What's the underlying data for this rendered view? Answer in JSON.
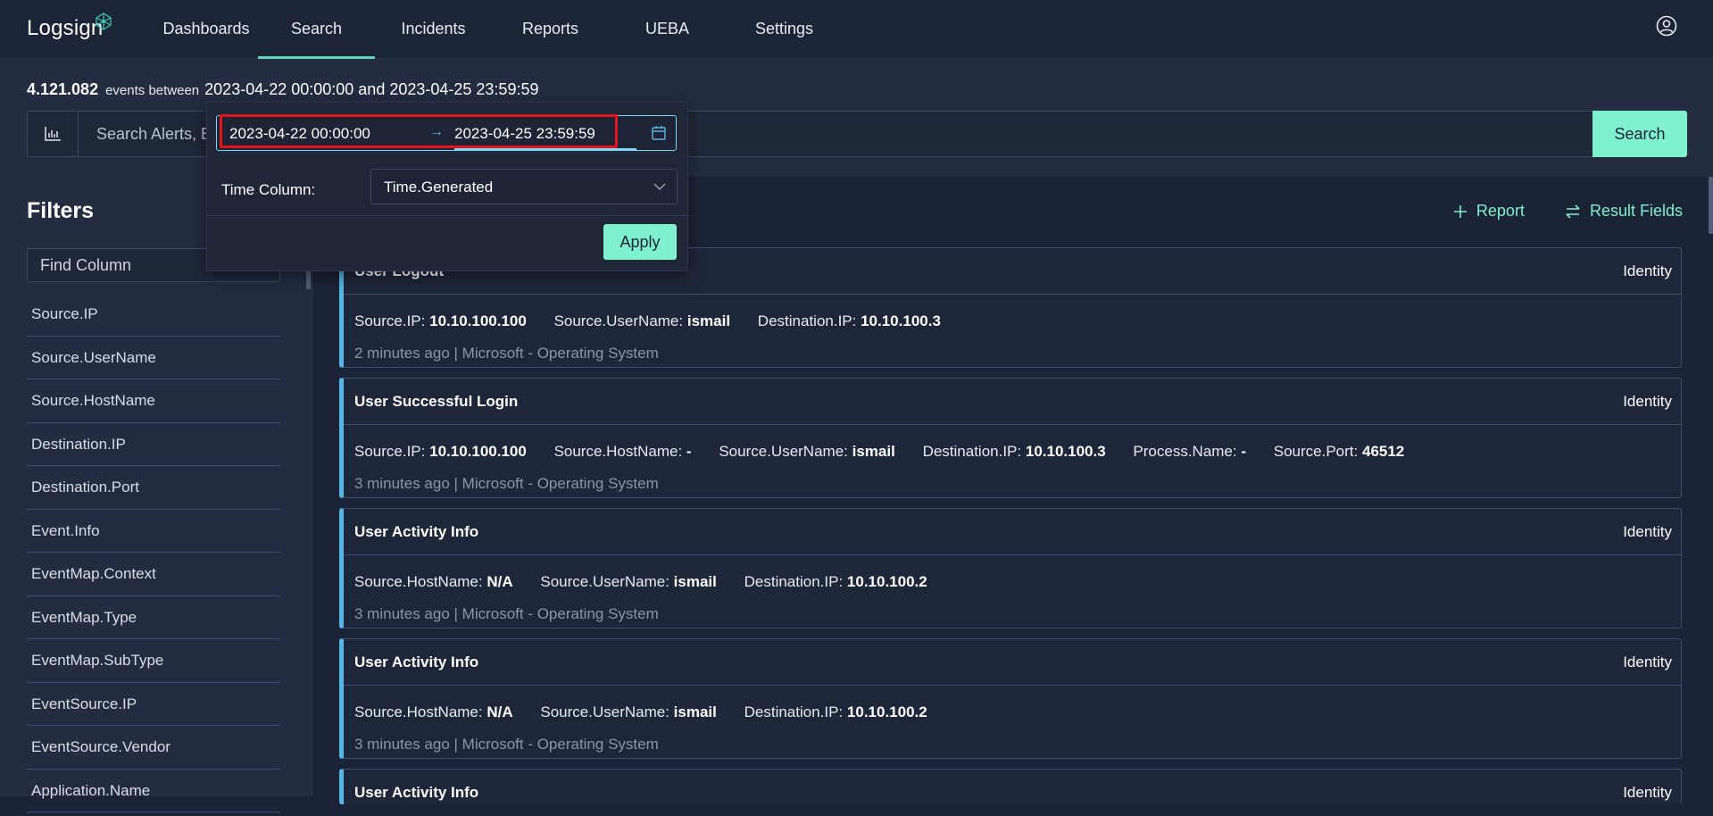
{
  "app": {
    "logo_text": "Logsign"
  },
  "nav": {
    "items": [
      "Dashboards",
      "Search",
      "Incidents",
      "Reports",
      "UEBA",
      "Settings"
    ],
    "active": "Search"
  },
  "stats": {
    "count": "4.121.082",
    "between_label": "events between",
    "range": "2023-04-22 00:00:00 and 2023-04-25 23:59:59"
  },
  "search": {
    "placeholder": "Search Alerts, Events",
    "button_label": "Search"
  },
  "date_popup": {
    "start": "2023-04-22 00:00:00",
    "arrow": "→",
    "end": "2023-04-25 23:59:59",
    "time_column_label": "Time Column:",
    "time_column_value": "Time.Generated",
    "apply_label": "Apply"
  },
  "filters": {
    "title": "Filters",
    "find_placeholder": "Find Column",
    "fields": [
      "Source.IP",
      "Source.UserName",
      "Source.HostName",
      "Destination.IP",
      "Destination.Port",
      "Event.Info",
      "EventMap.Context",
      "EventMap.Type",
      "EventMap.SubType",
      "EventSource.IP",
      "EventSource.Vendor",
      "Application.Name"
    ]
  },
  "results": {
    "report_label": "Report",
    "result_fields_label": "Result Fields",
    "cards": [
      {
        "title": "User Logout",
        "category": "Identity",
        "fields": [
          {
            "k": "Source.IP:",
            "v": "10.10.100.100"
          },
          {
            "k": "Source.UserName:",
            "v": "ismail"
          },
          {
            "k": "Destination.IP:",
            "v": "10.10.100.3"
          }
        ],
        "meta": "2 minutes ago | Microsoft - Operating System"
      },
      {
        "title": "User Successful Login",
        "category": "Identity",
        "fields": [
          {
            "k": "Source.IP:",
            "v": "10.10.100.100"
          },
          {
            "k": "Source.HostName:",
            "v": "-"
          },
          {
            "k": "Source.UserName:",
            "v": "ismail"
          },
          {
            "k": "Destination.IP:",
            "v": "10.10.100.3"
          },
          {
            "k": "Process.Name:",
            "v": "-"
          },
          {
            "k": "Source.Port:",
            "v": "46512"
          }
        ],
        "meta": "3 minutes ago | Microsoft - Operating System"
      },
      {
        "title": "User Activity Info",
        "category": "Identity",
        "fields": [
          {
            "k": "Source.HostName:",
            "v": "N/A"
          },
          {
            "k": "Source.UserName:",
            "v": "ismail"
          },
          {
            "k": "Destination.IP:",
            "v": "10.10.100.2"
          }
        ],
        "meta": "3 minutes ago | Microsoft - Operating System"
      },
      {
        "title": "User Activity Info",
        "category": "Identity",
        "fields": [
          {
            "k": "Source.HostName:",
            "v": "N/A"
          },
          {
            "k": "Source.UserName:",
            "v": "ismail"
          },
          {
            "k": "Destination.IP:",
            "v": "10.10.100.2"
          }
        ],
        "meta": "3 minutes ago | Microsoft - Operating System"
      },
      {
        "title": "User Activity Info",
        "category": "Identity",
        "fields": [],
        "meta": ""
      }
    ]
  },
  "colors": {
    "accent": "#7ff1cf",
    "card_border_left": "#57b6e9",
    "highlight": "#e3141c",
    "background": "#1b2336"
  }
}
